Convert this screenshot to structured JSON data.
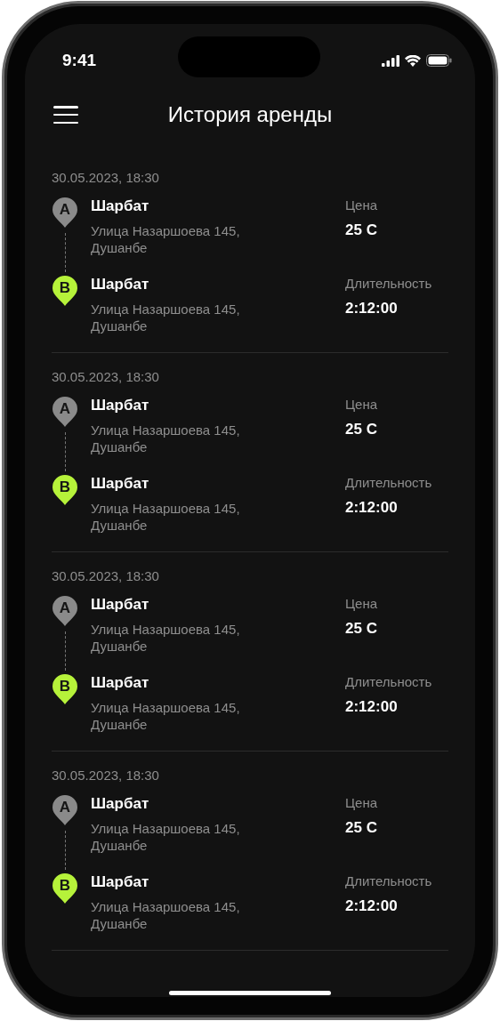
{
  "status_bar": {
    "time": "9:41"
  },
  "header": {
    "title": "История аренды"
  },
  "trips": [
    {
      "date": "30.05.2023, 18:30",
      "points": [
        {
          "kind": "start",
          "marker": "A",
          "name": "Шарбат",
          "address": "Улица Назаршоева 145, Душанбе"
        },
        {
          "kind": "end",
          "marker": "B",
          "name": "Шарбат",
          "address": "Улица Назаршоева 145, Душанбе"
        }
      ],
      "stats": [
        {
          "label": "Цена",
          "value": "25 С"
        },
        {
          "label": "Длительность",
          "value": "2:12:00"
        }
      ]
    },
    {
      "date": "30.05.2023, 18:30",
      "points": [
        {
          "kind": "start",
          "marker": "A",
          "name": "Шарбат",
          "address": "Улица Назаршоева 145, Душанбе"
        },
        {
          "kind": "end",
          "marker": "B",
          "name": "Шарбат",
          "address": "Улица Назаршоева 145, Душанбе"
        }
      ],
      "stats": [
        {
          "label": "Цена",
          "value": "25 С"
        },
        {
          "label": "Длительность",
          "value": "2:12:00"
        }
      ]
    },
    {
      "date": "30.05.2023, 18:30",
      "points": [
        {
          "kind": "start",
          "marker": "A",
          "name": "Шарбат",
          "address": "Улица Назаршоева 145, Душанбе"
        },
        {
          "kind": "end",
          "marker": "B",
          "name": "Шарбат",
          "address": "Улица Назаршоева 145, Душанбе"
        }
      ],
      "stats": [
        {
          "label": "Цена",
          "value": "25 С"
        },
        {
          "label": "Длительность",
          "value": "2:12:00"
        }
      ]
    },
    {
      "date": "30.05.2023, 18:30",
      "points": [
        {
          "kind": "start",
          "marker": "A",
          "name": "Шарбат",
          "address": "Улица Назаршоева 145, Душанбе"
        },
        {
          "kind": "end",
          "marker": "B",
          "name": "Шарбат",
          "address": "Улица Назаршоева 145, Душанбе"
        }
      ],
      "stats": [
        {
          "label": "Цена",
          "value": "25 С"
        },
        {
          "label": "Длительность",
          "value": "2:12:00"
        }
      ]
    }
  ]
}
